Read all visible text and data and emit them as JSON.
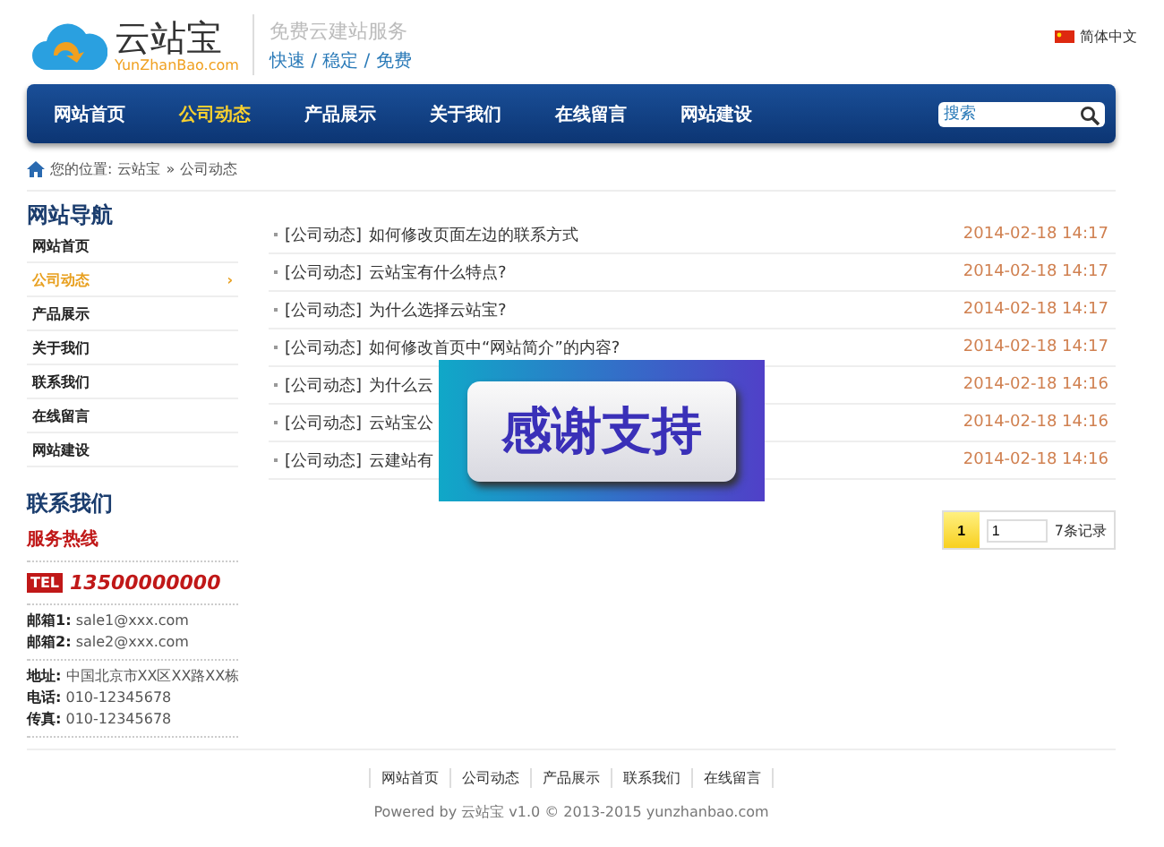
{
  "header": {
    "logo_name": "云站宝",
    "logo_domain": "YunZhanBao.com",
    "slogan": "免费云建站服务",
    "tagline": "快速 / 稳定 / 免费",
    "language": "简体中文"
  },
  "nav": [
    {
      "label": "网站首页",
      "selected": false
    },
    {
      "label": "公司动态",
      "selected": true
    },
    {
      "label": "产品展示",
      "selected": false
    },
    {
      "label": "关于我们",
      "selected": false
    },
    {
      "label": "在线留言",
      "selected": false
    },
    {
      "label": "网站建设",
      "selected": false
    }
  ],
  "search": {
    "placeholder": "搜索"
  },
  "breadcrumb": {
    "label": "您的位置:",
    "items": [
      "云站宝",
      "»",
      "公司动态"
    ]
  },
  "sidebar": {
    "title": "网站导航",
    "items": [
      {
        "label": "网站首页",
        "selected": false
      },
      {
        "label": "公司动态",
        "selected": true
      },
      {
        "label": "产品展示",
        "selected": false
      },
      {
        "label": "关于我们",
        "selected": false
      },
      {
        "label": "联系我们",
        "selected": false
      },
      {
        "label": "在线留言",
        "selected": false
      },
      {
        "label": "网站建设",
        "selected": false
      }
    ],
    "arrow": "›"
  },
  "contact": {
    "title": "联系我们",
    "hotline_title": "服务热线",
    "tel_badge": "TEL",
    "phone": "13500000000",
    "groups": [
      [
        {
          "label": "邮箱1:",
          "value": "sale1@xxx.com"
        },
        {
          "label": "邮箱2:",
          "value": "sale2@xxx.com"
        }
      ],
      [
        {
          "label": "地址:",
          "value": "中国北京市XX区XX路XX栋"
        },
        {
          "label": "电话:",
          "value": "010-12345678"
        },
        {
          "label": "传真:",
          "value": "010-12345678"
        }
      ]
    ]
  },
  "news": [
    {
      "category": "[公司动态]",
      "title": "如何修改页面左边的联系方式",
      "date": "2014-02-18 14:17"
    },
    {
      "category": "[公司动态]",
      "title": "云站宝有什么特点?",
      "date": "2014-02-18 14:17"
    },
    {
      "category": "[公司动态]",
      "title": "为什么选择云站宝?",
      "date": "2014-02-18 14:17"
    },
    {
      "category": "[公司动态]",
      "title": "如何修改首页中“网站简介”的内容?",
      "date": "2014-02-18 14:17"
    },
    {
      "category": "[公司动态]",
      "title": "为什么云",
      "date": "2014-02-18 14:16"
    },
    {
      "category": "[公司动态]",
      "title": "云站宝公",
      "date": "2014-02-18 14:16"
    },
    {
      "category": "[公司动态]",
      "title": "云建站有",
      "date": "2014-02-18 14:16"
    }
  ],
  "pagination": {
    "current": "1",
    "page_input": "1",
    "records": "7条记录"
  },
  "overlay": {
    "text": "感谢支持"
  },
  "footer": {
    "links": [
      "网站首页",
      "公司动态",
      "产品展示",
      "联系我们",
      "在线留言"
    ],
    "copyright": "Powered by 云站宝 v1.0 © 2013-2015 yunzhanbao.com"
  }
}
